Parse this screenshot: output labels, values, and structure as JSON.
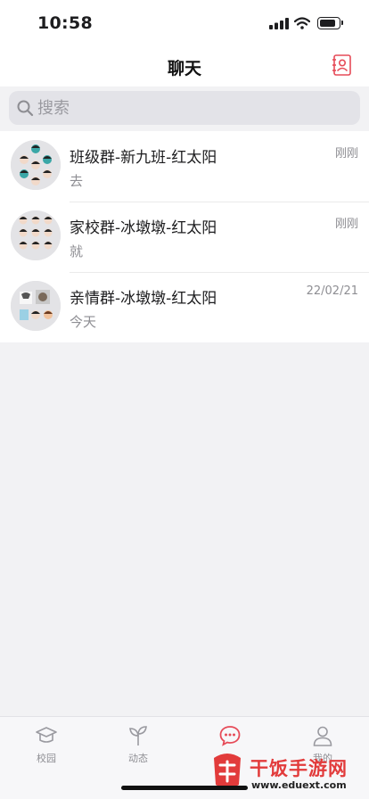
{
  "status_bar": {
    "time": "10:58"
  },
  "nav": {
    "title": "聊天"
  },
  "search": {
    "placeholder": "搜索"
  },
  "chats": [
    {
      "name": "班级群-新九班-红太阳",
      "preview": "去",
      "time": "刚刚"
    },
    {
      "name": "家校群-冰墩墩-红太阳",
      "preview": "就",
      "time": "刚刚"
    },
    {
      "name": "亲情群-冰墩墩-红太阳",
      "preview": "今天",
      "time": "22/02/21"
    }
  ],
  "tabs": [
    {
      "label": "校园",
      "icon": "graduation-cap-icon",
      "active": false
    },
    {
      "label": "动态",
      "icon": "sprout-icon",
      "active": false
    },
    {
      "label": "",
      "icon": "chat-bubble-icon",
      "active": true
    },
    {
      "label": "我的",
      "icon": "person-icon",
      "active": false
    }
  ],
  "watermark": {
    "title": "干饭手游网",
    "url": "www.eduext.com"
  },
  "colors": {
    "accent": "#e64b58",
    "background": "#f2f2f4",
    "secondary_text": "#8e8e93"
  }
}
